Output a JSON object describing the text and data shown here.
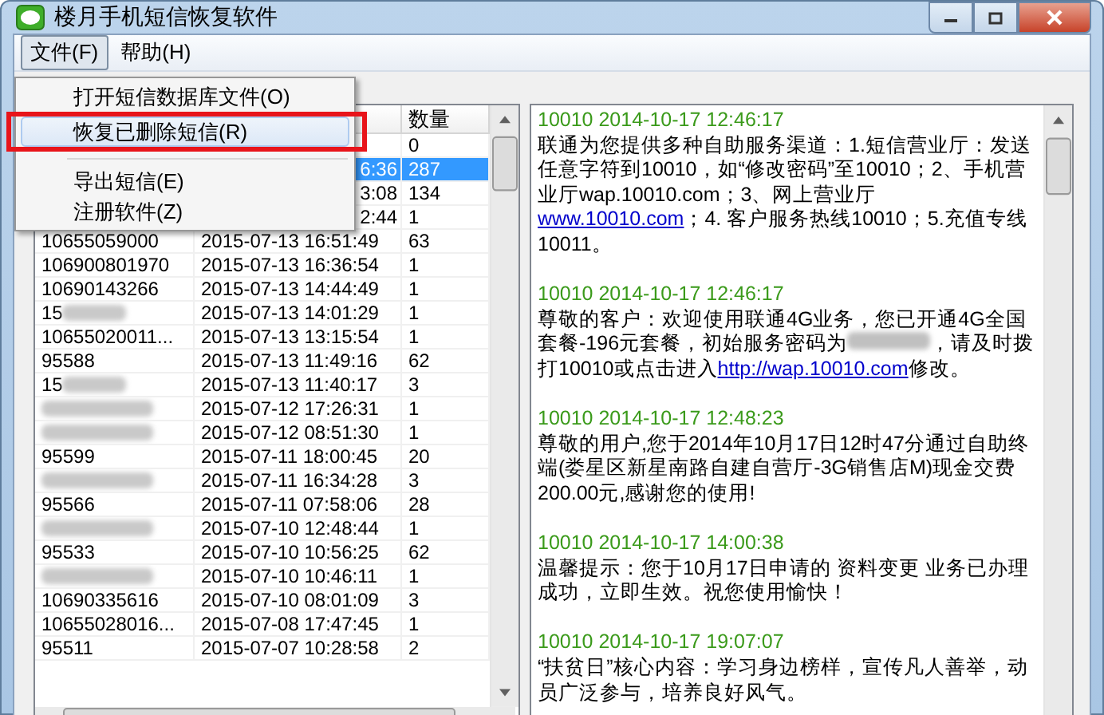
{
  "window": {
    "title": "楼月手机短信恢复软件"
  },
  "menu_bar": [
    {
      "label": "文件(F)",
      "selected": true
    },
    {
      "label": "帮助(H)",
      "selected": false
    }
  ],
  "file_menu": {
    "items": [
      {
        "kind": "command",
        "label": "打开短信数据库文件(O)",
        "hovered": false,
        "marked": false
      },
      {
        "kind": "command",
        "label": "恢复已删除短信(R)",
        "hovered": true,
        "marked": true
      },
      {
        "kind": "separator"
      },
      {
        "kind": "command",
        "label": "导出短信(E)",
        "hovered": false,
        "marked": false
      },
      {
        "kind": "command",
        "label": "注册软件(Z)",
        "hovered": false,
        "marked": false
      }
    ]
  },
  "message_list": {
    "columns": [
      {},
      {},
      {
        "label": "数量"
      }
    ],
    "rows": [
      {
        "count": "0",
        "selected": false
      },
      {
        "time": "6:36",
        "count": "287",
        "selected": true,
        "covered": true
      },
      {
        "time": "3:08",
        "count": "134",
        "selected": false,
        "covered": true
      },
      {
        "time": "2:44",
        "count": "1",
        "selected": false,
        "covered": true
      },
      {
        "number": "10655059000",
        "time": "2015-07-13 16:51:49",
        "count": "63",
        "selected": false,
        "covered": false
      },
      {
        "number": "106900801970",
        "time": "2015-07-13 16:36:54",
        "count": "1",
        "selected": false,
        "covered": false
      },
      {
        "number": "10690143266",
        "time": "2015-07-13 14:44:49",
        "count": "1",
        "selected": false,
        "covered": false
      },
      {
        "number": "15",
        "redacted": true,
        "time": "2015-07-13 14:01:29",
        "count": "1",
        "selected": false,
        "covered": false
      },
      {
        "number": "10655020011...",
        "time": "2015-07-13 13:15:54",
        "count": "1",
        "selected": false,
        "covered": false
      },
      {
        "number": "95588",
        "time": "2015-07-13 11:49:16",
        "count": "62",
        "selected": false,
        "covered": false
      },
      {
        "number": "15",
        "redacted": true,
        "time": "2015-07-13 11:40:17",
        "count": "3",
        "selected": false,
        "covered": false
      },
      {
        "redacted": true,
        "time": "2015-07-12 17:26:31",
        "count": "1",
        "selected": false,
        "covered": false
      },
      {
        "redacted": true,
        "time": "2015-07-12 08:51:30",
        "count": "1",
        "selected": false,
        "covered": false
      },
      {
        "number": "95599",
        "time": "2015-07-11 18:00:45",
        "count": "20",
        "selected": false,
        "covered": false
      },
      {
        "redacted": true,
        "time": "2015-07-11 16:34:28",
        "count": "3",
        "selected": false,
        "covered": false
      },
      {
        "number": "95566",
        "time": "2015-07-11 07:58:06",
        "count": "28",
        "selected": false,
        "covered": false
      },
      {
        "redacted": true,
        "time": "2015-07-10 12:48:44",
        "count": "1",
        "selected": false,
        "covered": false
      },
      {
        "number": "95533",
        "time": "2015-07-10 10:56:25",
        "count": "62",
        "selected": false,
        "covered": false
      },
      {
        "redacted": true,
        "time": "2015-07-10 10:46:11",
        "count": "1",
        "selected": false,
        "covered": false
      },
      {
        "number": "10690335616",
        "time": "2015-07-10 08:01:09",
        "count": "3",
        "selected": false,
        "covered": false
      },
      {
        "number": "10655028016...",
        "time": "2015-07-08 17:47:45",
        "count": "1",
        "selected": false,
        "covered": false
      },
      {
        "number": "95511",
        "time": "2015-07-07 10:28:58",
        "count": "2",
        "selected": false,
        "covered": false
      }
    ]
  },
  "messages": [
    {
      "header": "10010 2014-10-17 12:46:17",
      "body": [
        {
          "kind": "text",
          "text": "联通为您提供多种自助服务渠道：1.短信营业厅：发送任意字符到10010，如“修改密码”至10010；2、手机营业厅wap.10010.com；3、网上营业厅"
        },
        {
          "kind": "link",
          "text": "www.10010.com"
        },
        {
          "kind": "text",
          "text": "；4. 客户服务热线10010；5.充值专线10011。"
        }
      ]
    },
    {
      "header": "10010 2014-10-17 12:46:17",
      "body": [
        {
          "kind": "text",
          "text": "尊敬的客户：欢迎使用联通4G业务，您已开通4G全国套餐-196元套餐，初始服务密码为"
        },
        {
          "kind": "redacted"
        },
        {
          "kind": "text",
          "text": "，请及时拨打10010或点击进入"
        },
        {
          "kind": "link",
          "text": "http://wap.10010.com"
        },
        {
          "kind": "text",
          "text": "修改。"
        }
      ]
    },
    {
      "header": "10010 2014-10-17 12:48:23",
      "body": [
        {
          "kind": "text",
          "text": "尊敬的用户,您于2014年10月17日12时47分通过自助终端(娄星区新星南路自建自营厅-3G销售店M)现金交费200.00元,感谢您的使用!"
        }
      ]
    },
    {
      "header": "10010 2014-10-17 14:00:38",
      "body": [
        {
          "kind": "text",
          "text": "温馨提示：您于10月17日申请的 资料变更 业务已办理成功，立即生效。祝您使用愉快！"
        }
      ]
    },
    {
      "header": "10010 2014-10-17 19:07:07",
      "body": [
        {
          "kind": "text",
          "text": "“扶贫日”核心内容：学习身边榜样，宣传凡人善举，动员广泛参与，培养良好风气。"
        }
      ]
    }
  ]
}
